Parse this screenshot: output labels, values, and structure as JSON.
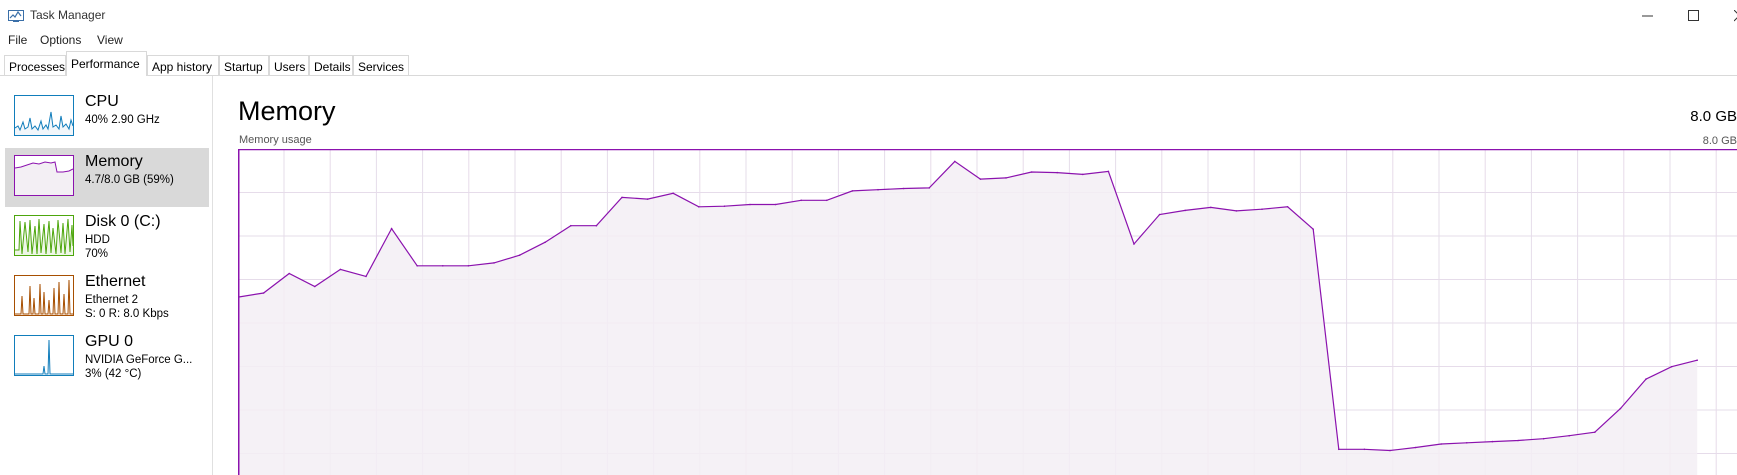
{
  "window": {
    "title": "Task Manager"
  },
  "menu": [
    "File",
    "Options",
    "View"
  ],
  "tabs": [
    {
      "label": "Processes",
      "active": false
    },
    {
      "label": "Performance",
      "active": true
    },
    {
      "label": "App history",
      "active": false
    },
    {
      "label": "Startup",
      "active": false
    },
    {
      "label": "Users",
      "active": false
    },
    {
      "label": "Details",
      "active": false
    },
    {
      "label": "Services",
      "active": false
    }
  ],
  "sidebar": {
    "items": [
      {
        "id": "cpu",
        "title": "CPU",
        "lines": [
          "40%  2.90 GHz"
        ],
        "color": "#117dbb",
        "selected": false
      },
      {
        "id": "memory",
        "title": "Memory",
        "lines": [
          "4.7/8.0 GB (59%)"
        ],
        "color": "#8b12ae",
        "selected": true
      },
      {
        "id": "disk",
        "title": "Disk 0 (C:)",
        "lines": [
          "HDD",
          "70%"
        ],
        "color": "#4da60c",
        "selected": false
      },
      {
        "id": "ethernet",
        "title": "Ethernet",
        "lines": [
          "Ethernet 2",
          "S: 0  R: 8.0 Kbps"
        ],
        "color": "#a74f01",
        "selected": false
      },
      {
        "id": "gpu",
        "title": "GPU 0",
        "lines": [
          "NVIDIA GeForce G...",
          "3%  (42 °C)"
        ],
        "color": "#117dbb",
        "selected": false
      }
    ]
  },
  "main": {
    "title": "Memory",
    "capacity": "8.0 GB",
    "usage_label": "Memory usage",
    "usage_max": "8.0 GB"
  },
  "chart_data": {
    "type": "area",
    "title": "Memory usage",
    "ylabel": "",
    "ylim": [
      0,
      8.0
    ],
    "unit": "GB",
    "color": "#8b12ae",
    "fill": "#f3eff4",
    "grid": true,
    "values": [
      5.49,
      5.56,
      5.89,
      5.67,
      5.96,
      5.84,
      6.65,
      6.02,
      6.02,
      6.02,
      6.07,
      6.2,
      6.42,
      6.7,
      6.7,
      7.18,
      7.15,
      7.25,
      7.02,
      7.03,
      7.06,
      7.06,
      7.13,
      7.13,
      7.29,
      7.31,
      7.33,
      7.34,
      7.79,
      7.49,
      7.51,
      7.61,
      7.6,
      7.57,
      7.62,
      6.39,
      6.89,
      6.96,
      7.01,
      6.95,
      6.98,
      7.02,
      6.64,
      2.91,
      2.91,
      2.89,
      2.94,
      3.0,
      3.02,
      3.04,
      3.06,
      3.09,
      3.14,
      3.2,
      3.6,
      4.1,
      4.31,
      4.42
    ]
  }
}
